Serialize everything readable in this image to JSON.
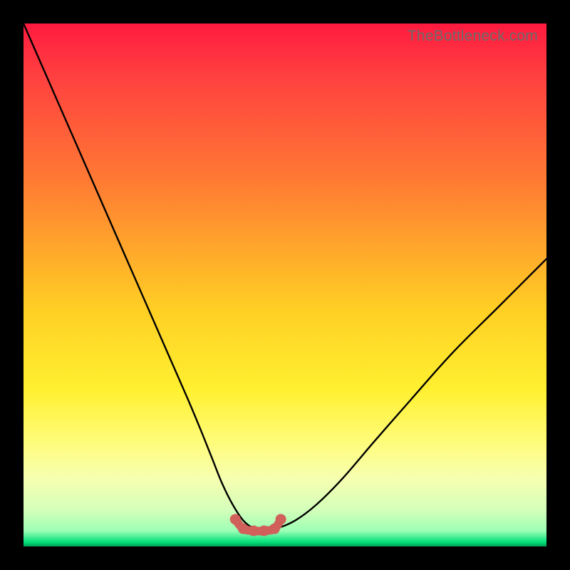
{
  "watermark": {
    "text": "TheBottleneck.com"
  },
  "colors": {
    "background": "#000000",
    "curve": "#000000",
    "marker_stroke": "#d1605b",
    "marker_fill": "#d1605b",
    "gradient_top": "#ff1a3f",
    "gradient_mid": "#fff030",
    "gradient_bottom": "#00e07a"
  },
  "chart_data": {
    "type": "line",
    "title": "",
    "xlabel": "",
    "ylabel": "",
    "xlim": [
      0,
      100
    ],
    "ylim": [
      0,
      100
    ],
    "grid": false,
    "legend": false,
    "note": "Axes are hidden in the image; x/y units are percentage of plot width/height read from pixels (y = 0 at bottom, 100 at top).",
    "series": [
      {
        "name": "bottleneck-curve",
        "x": [
          0,
          3.5,
          7,
          10.5,
          14,
          17.5,
          21,
          24.5,
          28,
          31.5,
          34,
          36,
          38,
          40,
          42,
          44,
          46,
          48.5,
          52,
          56,
          61,
          67,
          74,
          82,
          91,
          100
        ],
        "y": [
          100,
          92,
          84,
          76,
          68,
          60,
          52,
          44,
          36,
          28,
          22,
          17,
          12,
          8,
          5,
          3.5,
          3,
          3.5,
          5,
          8,
          13,
          20,
          28,
          37,
          46,
          55
        ]
      },
      {
        "name": "trough-markers",
        "style": "points-with-segment",
        "x": [
          40.5,
          42,
          44,
          46,
          48,
          49.2
        ],
        "y": [
          5.2,
          3.4,
          3,
          3,
          3.4,
          5.2
        ]
      }
    ]
  }
}
